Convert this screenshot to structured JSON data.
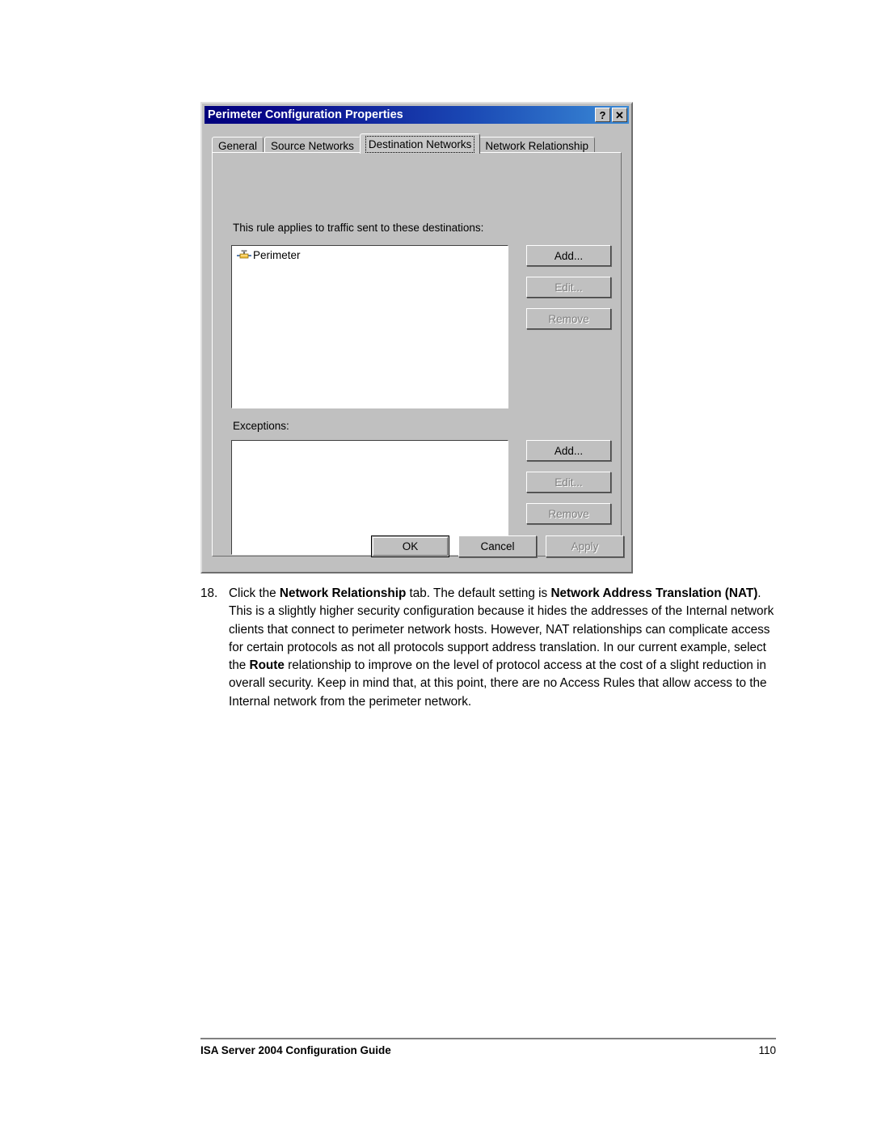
{
  "dialog": {
    "title": "Perimeter Configuration Properties",
    "title_buttons": {
      "help": "?",
      "close": "✕"
    },
    "tabs": [
      {
        "label": "General",
        "active": false
      },
      {
        "label": "Source Networks",
        "active": false
      },
      {
        "label": "Destination Networks",
        "active": true
      },
      {
        "label": "Network Relationship",
        "active": false
      }
    ],
    "destinations": {
      "label": "This rule applies to traffic sent to these destinations:",
      "items": [
        {
          "name": "Perimeter",
          "icon": "network-icon"
        }
      ],
      "buttons": {
        "add": "Add...",
        "edit": "Edit...",
        "remove": "Remove"
      }
    },
    "exceptions": {
      "label": "Exceptions:",
      "items": [],
      "buttons": {
        "add": "Add...",
        "edit": "Edit...",
        "remove": "Remove"
      }
    },
    "footer_buttons": {
      "ok": "OK",
      "cancel": "Cancel",
      "apply": "Apply"
    }
  },
  "body": {
    "step_number": "18.",
    "step_text_html": "Click the <b>Network Relationship</b> tab. The default setting is <b>Network Address Translation (NAT)</b>. This is a slightly higher security configuration because it hides the addresses of the Internal network clients that connect to perimeter network hosts. However, NAT relationships can complicate access for certain protocols as not all protocols support address translation. In our current example, select the <b>Route</b> relationship to improve on the level of protocol access at the cost of a slight reduction in overall security. Keep in mind that, at this point, there are no Access Rules that allow access to the Internal network from the perimeter network."
  },
  "page_footer": {
    "title": "ISA Server 2004 Configuration Guide",
    "page_number": "110"
  },
  "colors": {
    "titlebar_start": "#00007b",
    "titlebar_end": "#3a8ad6",
    "dialog_face": "#c0c0c0",
    "listbox_bg": "#ffffff",
    "disabled_text": "#808080",
    "footer_rule": "#808080"
  }
}
